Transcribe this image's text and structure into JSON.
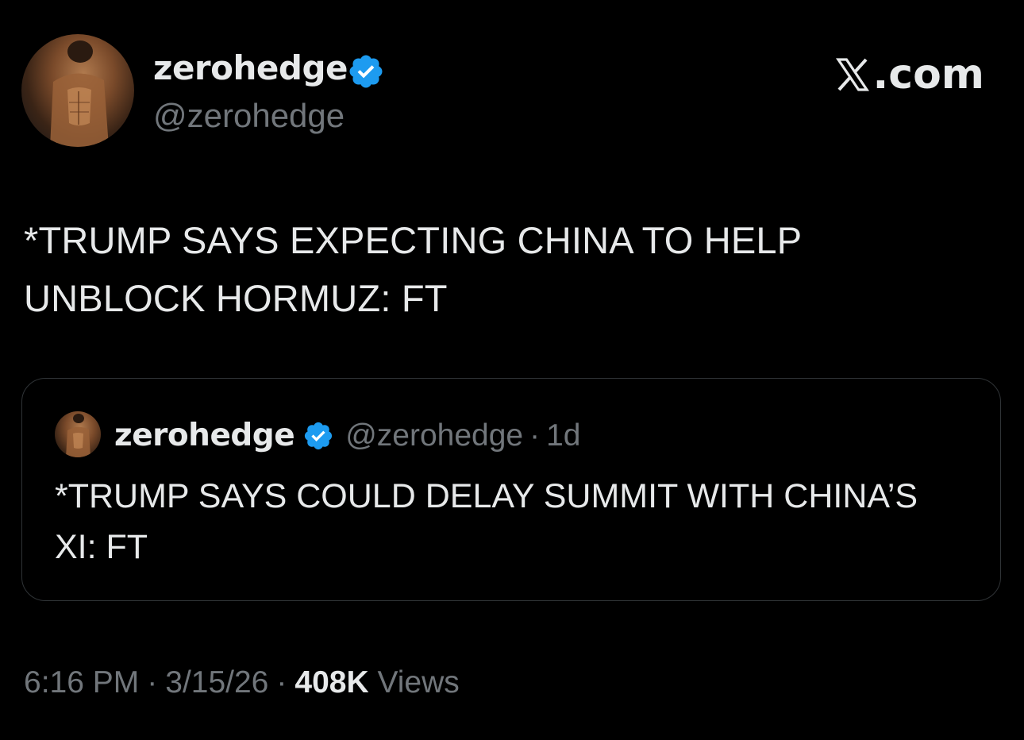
{
  "author": {
    "display_name": "zerohedge",
    "handle": "@zerohedge",
    "verified": true,
    "avatar": "profile-photo"
  },
  "watermark": {
    "text": ".com",
    "icon": "x-logo-icon"
  },
  "tweet": {
    "text": "*TRUMP SAYS EXPECTING CHINA TO HELP UNBLOCK HORMUZ: FT"
  },
  "quoted_tweet": {
    "display_name": "zerohedge",
    "handle": "@zerohedge",
    "separator": "·",
    "time": "1d",
    "text": "*TRUMP SAYS COULD DELAY SUMMIT WITH CHINA’S XI: FT"
  },
  "meta": {
    "time": "6:16 PM",
    "date": "3/15/26",
    "separator": "·",
    "views_count": "408K",
    "views_label": "Views"
  },
  "colors": {
    "background": "#000000",
    "primary_text": "#e7e9ea",
    "secondary_text": "#71767b",
    "verified_badge": "#1d9bf0",
    "border": "#2f3336"
  }
}
